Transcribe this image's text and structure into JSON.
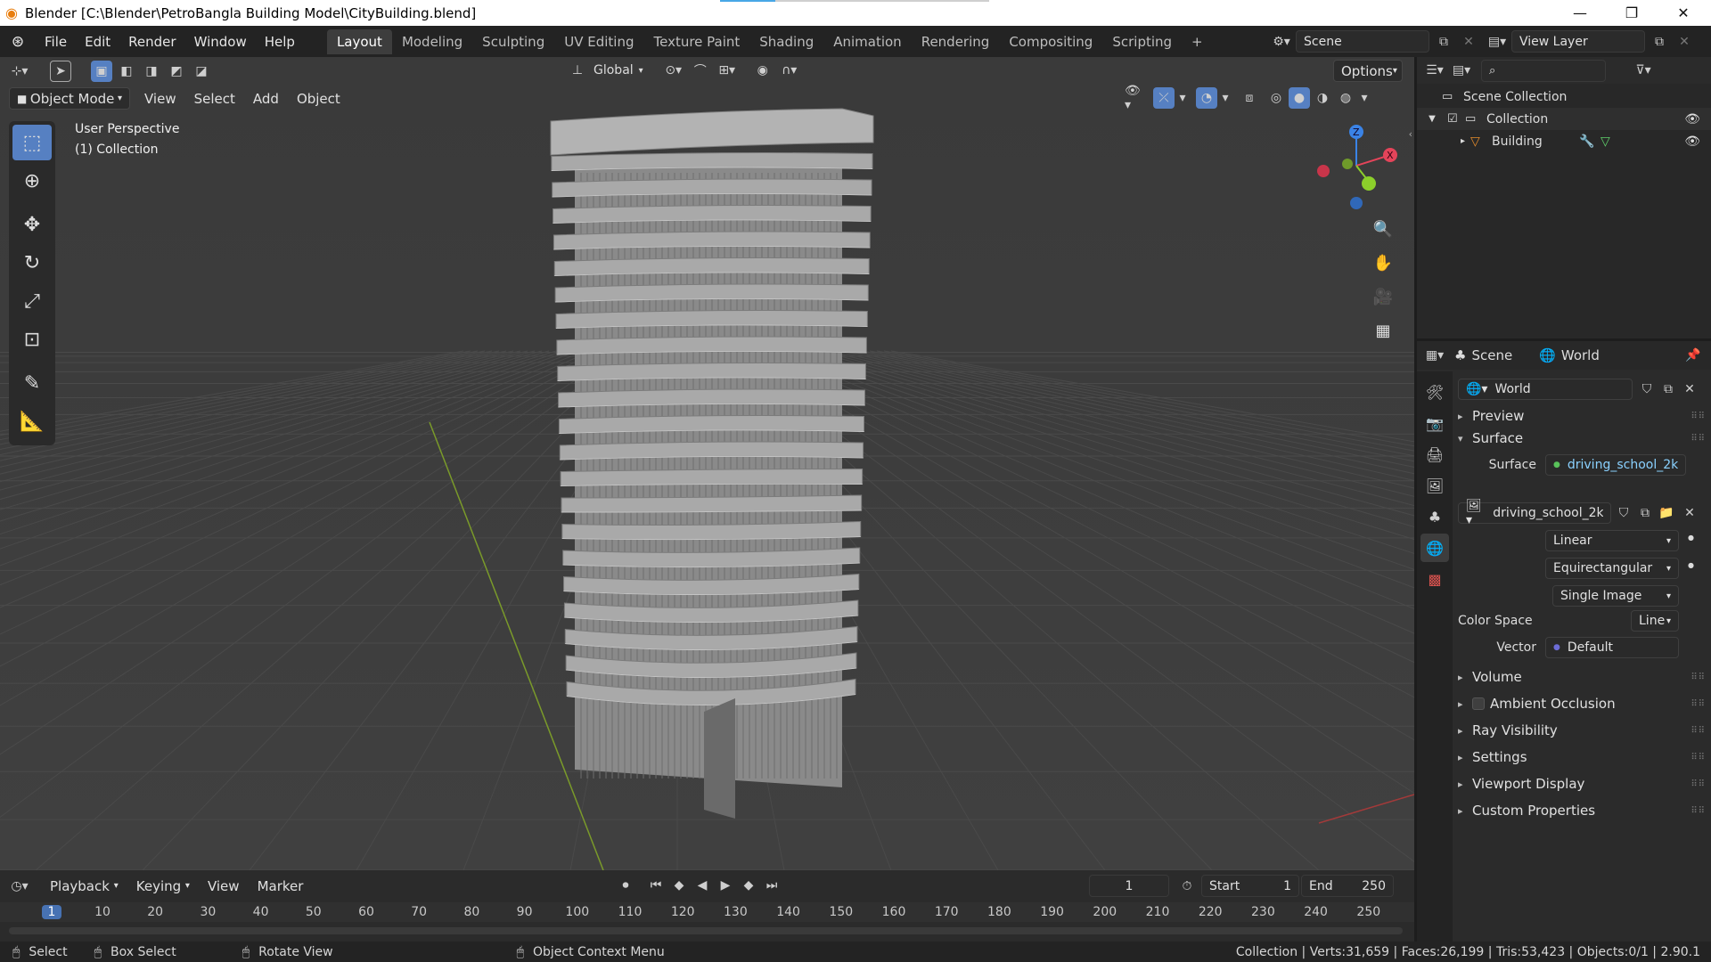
{
  "window": {
    "title": "Blender [C:\\Blender\\PetroBangla Building Model\\CityBuilding.blend]",
    "minimize": "—",
    "maximize": "❐",
    "close": "✕"
  },
  "menubar": {
    "items": [
      "File",
      "Edit",
      "Render",
      "Window",
      "Help"
    ],
    "workspaces": [
      "Layout",
      "Modeling",
      "Sculpting",
      "UV Editing",
      "Texture Paint",
      "Shading",
      "Animation",
      "Rendering",
      "Compositing",
      "Scripting"
    ],
    "add_workspace": "+",
    "scene_name": "Scene",
    "view_layer": "View Layer"
  },
  "viewport_header": {
    "orientation": "Global",
    "options": "Options",
    "mode": "Object Mode",
    "menus": [
      "View",
      "Select",
      "Add",
      "Object"
    ]
  },
  "viewport": {
    "perspective": "User Perspective",
    "collection": "(1) Collection",
    "gizmo": {
      "x": "X",
      "y": "Y",
      "z": "Z"
    }
  },
  "outliner": {
    "search_placeholder": "",
    "scene_collection": "Scene Collection",
    "collection": "Collection",
    "object": "Building"
  },
  "properties": {
    "breadcrumb_scene": "Scene",
    "breadcrumb_world": "World",
    "world_name": "World",
    "panels": {
      "preview": "Preview",
      "surface": "Surface",
      "volume": "Volume",
      "ambient_occlusion": "Ambient Occlusion",
      "ray_visibility": "Ray Visibility",
      "settings": "Settings",
      "viewport_display": "Viewport Display",
      "custom_properties": "Custom Properties"
    },
    "surface_label": "Surface",
    "surface_value": "driving_school_2k....",
    "image_name": "driving_school_2k...",
    "interpolation": "Linear",
    "projection": "Equirectangular",
    "source": "Single Image",
    "color_space_label": "Color Space",
    "color_space_value": "Line",
    "vector_label": "Vector",
    "vector_value": "Default"
  },
  "timeline": {
    "menus": [
      "Playback",
      "Keying",
      "View",
      "Marker"
    ],
    "current_frame": "1",
    "start_label": "Start",
    "start_value": "1",
    "end_label": "End",
    "end_value": "250",
    "ruler": [
      "1",
      "10",
      "20",
      "30",
      "40",
      "50",
      "60",
      "70",
      "80",
      "90",
      "100",
      "110",
      "120",
      "130",
      "140",
      "150",
      "160",
      "170",
      "180",
      "190",
      "200",
      "210",
      "220",
      "230",
      "240",
      "250"
    ]
  },
  "statusbar": {
    "select": "Select",
    "box_select": "Box Select",
    "rotate_view": "Rotate View",
    "context_menu": "Object Context Menu",
    "stats": "Collection | Verts:31,659 | Faces:26,199 | Tris:53,423 | Objects:0/1 | 2.90.1"
  },
  "colors": {
    "accent": "#5680c2",
    "viewport_bg": "#3d3d3d",
    "building": "#a9a9a9",
    "axis_x": "#e5445a",
    "axis_y": "#8ccf2b",
    "axis_z": "#3a83e6",
    "world_tab": "#3b7ee0"
  }
}
